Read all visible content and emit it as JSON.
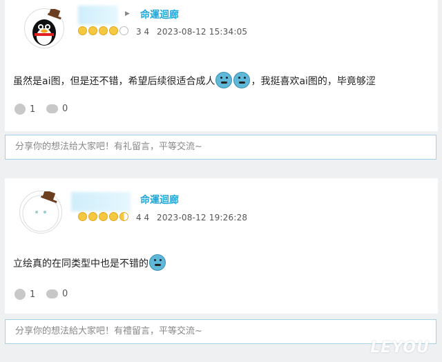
{
  "comments": [
    {
      "username": "命運迴廊",
      "stars": [
        "full",
        "full",
        "full",
        "full",
        "empty"
      ],
      "level": "3 4",
      "timestamp": "2023-08-12 15:34:05",
      "content_before": "虽然是ai图，但是还不错，希望后续很适合成人",
      "content_after": "，我挺喜欢ai图的，毕竟够涩",
      "likes": "1",
      "replies": "0",
      "reply_placeholder": "分享你的想法给大家吧！有礼留言，平等交流~"
    },
    {
      "username": "命運迴廊",
      "stars": [
        "full",
        "full",
        "full",
        "full",
        "half"
      ],
      "level": "4 4",
      "timestamp": "2023-08-12 19:26:28",
      "content_before": "立绘真的在同类型中也是不错的",
      "content_after": "",
      "likes": "1",
      "replies": "0",
      "reply_placeholder": "分享你的想法給大家吧！有禮留言，平等交流~"
    }
  ],
  "watermark": "LEYOU"
}
